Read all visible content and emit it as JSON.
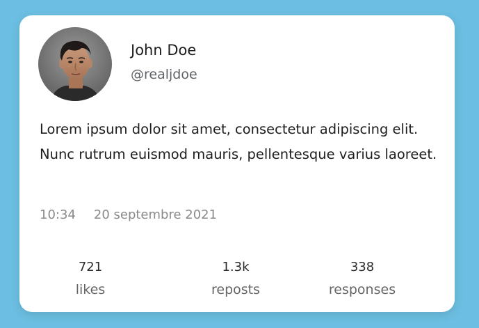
{
  "profile": {
    "name": "John Doe",
    "handle": "@realjdoe"
  },
  "post": {
    "text": "Lorem ipsum dolor sit amet, consectetur adipiscing elit. Nunc rutrum euismod mauris, pellentesque varius laoreet.",
    "time": "10:34",
    "date": "20 septembre 2021"
  },
  "stats": {
    "likes": {
      "value": "721",
      "label": "likes"
    },
    "reposts": {
      "value": "1.3k",
      "label": "reposts"
    },
    "responses": {
      "value": "338",
      "label": "responses"
    }
  },
  "colors": {
    "background": "#6cbfe2",
    "card": "#ffffff",
    "text": "#1d1d1f",
    "muted": "#8a8a8a"
  }
}
